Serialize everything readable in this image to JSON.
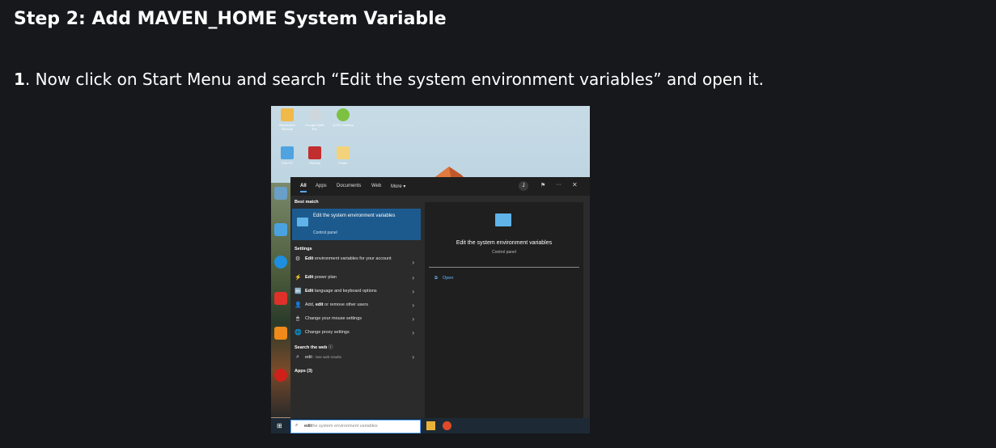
{
  "heading": "Step 2: Add MAVEN_HOME System Variable",
  "instruction": {
    "number": "1",
    "text": ". Now click on Start Menu and search “Edit the system environment variables” and open it."
  },
  "screenshot": {
    "desktop_icons": [
      {
        "label": "Bluestacks Remote",
        "color": "#f0b94a"
      },
      {
        "label": "Google Earth Pro",
        "color": "#cfd7dd"
      },
      {
        "label": "QGIS Desktop",
        "color": "#7cc142"
      },
      {
        "label": "This PC",
        "color": "#4fa3e0"
      },
      {
        "label": "FileZilla",
        "color": "#c22d2d"
      },
      {
        "label": "Folder",
        "color": "#f2d27a"
      }
    ],
    "menu_tabs": [
      "All",
      "Apps",
      "Documents",
      "Web",
      "More ▾"
    ],
    "avatar": "J",
    "best_match_label": "Best match",
    "best_match": {
      "title": "Edit the system environment variables",
      "subtitle": "Control panel"
    },
    "settings_label": "Settings",
    "settings_items": [
      {
        "bold": "Edit",
        "rest": " environment variables for your account",
        "icon": "⚙"
      },
      {
        "bold": "Edit",
        "rest": " power plan",
        "icon": "⚡"
      },
      {
        "bold": "Edit",
        "rest": " language and keyboard options",
        "icon": "🔤"
      },
      {
        "bold": "edit",
        "pre": "Add, ",
        "rest": " or remove other users",
        "icon": "👤"
      },
      {
        "bold": "",
        "rest": "Change your mouse settings",
        "icon": "🖱"
      },
      {
        "bold": "",
        "rest": "Change proxy settings",
        "icon": "🌐"
      }
    ],
    "search_web_label": "Search the web",
    "web_result": {
      "term": "edit",
      "suffix": " - See web results"
    },
    "apps_label": "Apps (3)",
    "right_pane": {
      "title": "Edit the system environment variables",
      "subtitle": "Control panel",
      "open_label": "Open"
    },
    "search_box": {
      "typed": "edit",
      "ghost": "the system environment variables"
    },
    "left_strip_labels": [
      "Rec",
      "Comm",
      "Microsoft Edge",
      "AnyDesk",
      "VLC media player",
      "Opera browser"
    ]
  }
}
